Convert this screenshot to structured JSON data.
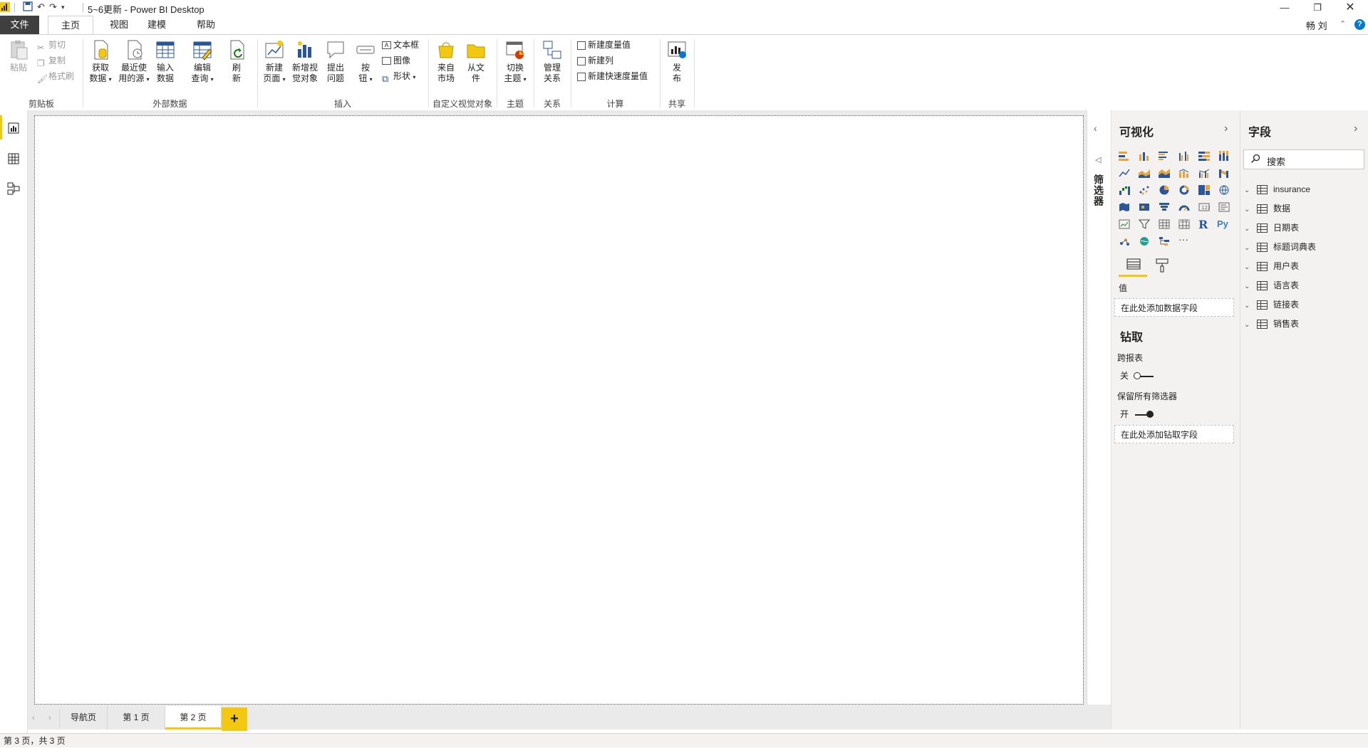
{
  "window": {
    "title": "5~6更新 - Power BI Desktop",
    "user": "畅 刘"
  },
  "tabs": {
    "file": "文件",
    "home": "主页",
    "view": "视图",
    "modeling": "建模",
    "help": "帮助"
  },
  "ribbon": {
    "clipboard": {
      "paste": "粘贴",
      "cut": "剪切",
      "copy": "复制",
      "format_painter": "格式刷",
      "group": "剪贴板"
    },
    "external_data": {
      "get_data_1": "获取",
      "get_data_2": "数据",
      "recent_1": "最近使",
      "recent_2": "用的源",
      "enter_1": "输入",
      "enter_2": "数据",
      "edit_1": "编辑",
      "edit_2": "查询",
      "refresh_1": "刷",
      "refresh_2": "新",
      "group": "外部数据"
    },
    "insert": {
      "new_page_1": "新建",
      "new_page_2": "页面",
      "new_visual_1": "新增视",
      "new_visual_2": "觉对象",
      "ask_1": "提出",
      "ask_2": "问题",
      "buttons_1": "按",
      "buttons_2": "钮",
      "text_box": "文本框",
      "image": "图像",
      "shapes": "形状",
      "group": "插入"
    },
    "custom_visuals": {
      "from_market_1": "来自",
      "from_market_2": "市场",
      "from_file_1": "从文",
      "from_file_2": "件",
      "group": "自定义视觉对象"
    },
    "themes": {
      "switch_1": "切换",
      "switch_2": "主题",
      "group": "主题"
    },
    "relationships": {
      "manage_1": "管理",
      "manage_2": "关系",
      "group": "关系"
    },
    "calculations": {
      "new_measure": "新建度量值",
      "new_column": "新建列",
      "new_quick_measure": "新建快速度量值",
      "group": "计算"
    },
    "share": {
      "publish_1": "发",
      "publish_2": "布",
      "group": "共享"
    }
  },
  "filters": {
    "label": "筛选器"
  },
  "visualizations": {
    "title": "可视化",
    "values_label": "值",
    "values_placeholder": "在此处添加数据字段",
    "drillthrough_title": "钻取",
    "cross_report_label": "跨报表",
    "cross_report_state": "关",
    "keep_filters_label": "保留所有筛选器",
    "keep_filters_state": "开",
    "drill_placeholder": "在此处添加钻取字段",
    "r_icon": "R",
    "py_icon": "Py",
    "more_icon": "···"
  },
  "fields": {
    "title": "字段",
    "search_placeholder": "搜索",
    "tables": [
      "insurance",
      "数据",
      "日期表",
      "标题词典表",
      "用户表",
      "语言表",
      "链接表",
      "销售表"
    ]
  },
  "pages": {
    "tabs": [
      "导航页",
      "第 1 页",
      "第 2 页"
    ],
    "active_index": 2,
    "add": "+"
  },
  "status": {
    "text": "第 3 页，共 3 页"
  },
  "colors": {
    "accent": "#f2c811",
    "file_tab": "#3f3f3f",
    "pane_bg": "#f3f2f1"
  }
}
